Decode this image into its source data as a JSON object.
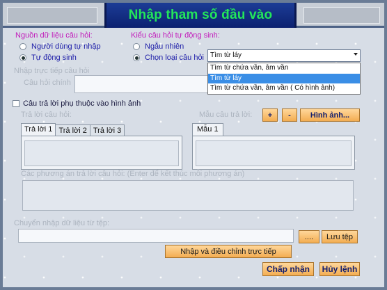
{
  "window": {
    "title": "Nhập tham số đầu vào"
  },
  "source_group": {
    "label": "Nguồn dữ liệu câu hỏi:",
    "options": [
      {
        "label": "Người dùng tự nhập",
        "selected": false
      },
      {
        "label": "Tự động sinh",
        "selected": true
      }
    ]
  },
  "type_group": {
    "label": "Kiểu câu hỏi tự động sinh:",
    "options": [
      {
        "label": "Ngẫu nhiên",
        "selected": false
      },
      {
        "label": "Chọn loại câu hỏi",
        "selected": true
      }
    ],
    "select": {
      "value": "Tìm từ láy",
      "options": [
        "Tìm từ chứa vần, âm vần",
        "Tìm từ láy",
        "Tìm từ chứa vần, âm vần ( Có hình ảnh)"
      ],
      "highlighted_index": 1
    }
  },
  "direct_input": {
    "group_label": "Nhập trực tiếp câu hỏi",
    "question_label": "Câu hỏi chính",
    "question_value": ""
  },
  "image_checkbox": {
    "label": "Câu trả lời phụ thuộc vào hình ảnh",
    "checked": false
  },
  "answers": {
    "label": "Trả lời câu hỏi:",
    "tabs": [
      "Trả lời 1",
      "Trả lời 2",
      "Trả lời 3"
    ],
    "active_tab": 0
  },
  "samples": {
    "label": "Mẫu câu trả lời:",
    "add_label": "+",
    "remove_label": "-",
    "image_button": "Hình ảnh...",
    "tabs": [
      "Mẫu 1"
    ],
    "active_tab": 0
  },
  "options_area": {
    "label": "Các phương án trả lời câu hỏi: (Enter để kết thúc mỗi phương án)"
  },
  "file_import": {
    "label": "Chuyển nhập dữ liệu từ tệp:",
    "path_value": "",
    "browse_label": "....",
    "save_label": "Lưu tệp",
    "edit_label": "Nhập và điều chỉnh trực tiếp"
  },
  "footer": {
    "accept_label": "Chấp nhận",
    "cancel_label": "Hủy lệnh"
  }
}
